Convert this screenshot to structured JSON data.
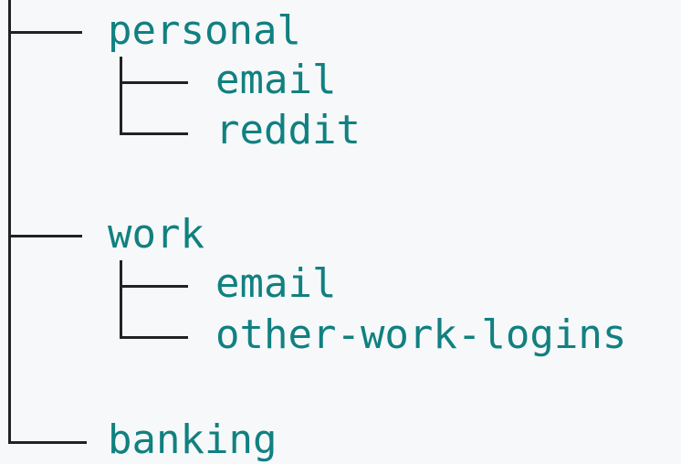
{
  "tree": {
    "accent_color": "#118080",
    "connector_color": "#222222",
    "root_children": [
      {
        "label": "personal",
        "children": [
          {
            "label": "email"
          },
          {
            "label": "reddit"
          }
        ]
      },
      {
        "label": "work",
        "children": [
          {
            "label": "email"
          },
          {
            "label": "other-work-logins"
          }
        ]
      },
      {
        "label": "banking",
        "children": []
      }
    ]
  }
}
